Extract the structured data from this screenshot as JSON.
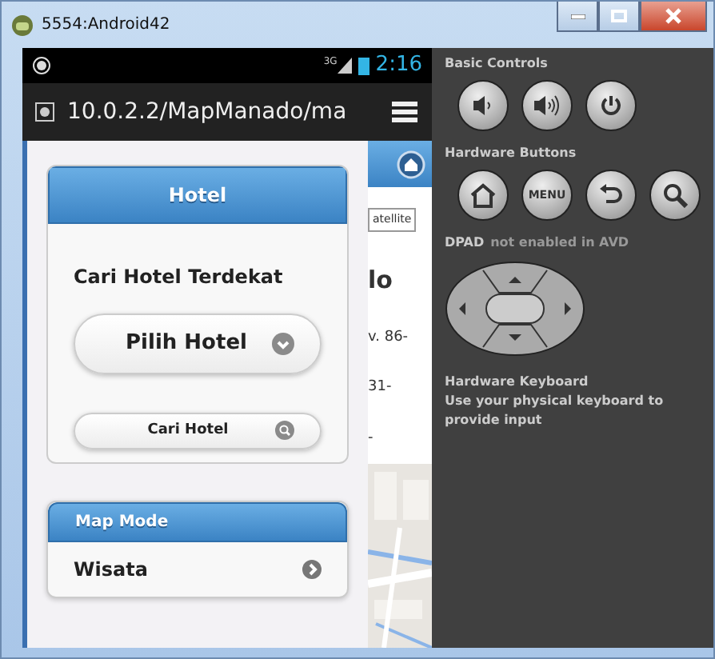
{
  "window": {
    "title": "5554:Android42"
  },
  "status_bar": {
    "network": "3G",
    "time": "2:16"
  },
  "browser": {
    "url": "10.0.2.2/MapManado/ma"
  },
  "map": {
    "satellite_button": "atellite",
    "text_lines": [
      "lo",
      "v. 86-",
      "31-",
      "-"
    ]
  },
  "hotel_section": {
    "title": "Hotel",
    "heading": "Cari Hotel Terdekat",
    "select": "Pilih Hotel",
    "search_button": "Cari Hotel"
  },
  "map_mode": {
    "title": "Map Mode",
    "items": [
      {
        "label": "Wisata"
      }
    ]
  },
  "basic_controls": {
    "title": "Basic Controls",
    "buttons": [
      {
        "kind": "volume-down"
      },
      {
        "kind": "volume-up"
      },
      {
        "kind": "power"
      }
    ]
  },
  "hardware_buttons": {
    "title": "Hardware Buttons",
    "buttons": [
      {
        "kind": "home"
      },
      {
        "kind": "text",
        "label": "MENU"
      },
      {
        "kind": "back"
      },
      {
        "kind": "search"
      }
    ]
  },
  "dpad": {
    "name": "DPAD",
    "note": "not enabled in AVD"
  },
  "keyboard": {
    "title": "Hardware Keyboard",
    "note": "Use your physical keyboard to provide input"
  }
}
